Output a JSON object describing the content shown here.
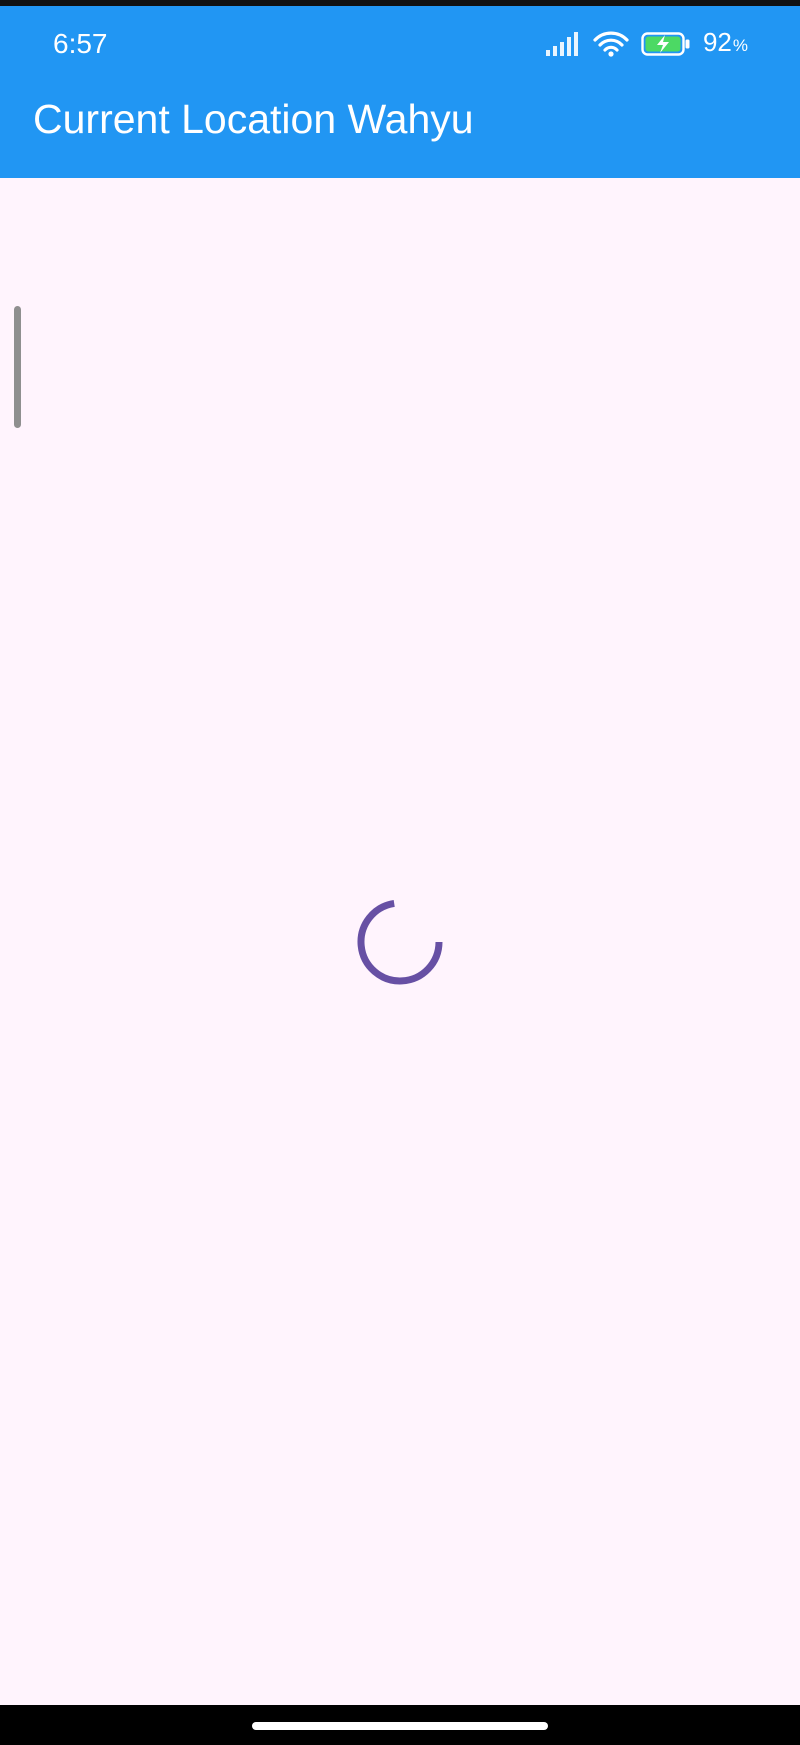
{
  "status_bar": {
    "time": "6:57",
    "battery_value": "92",
    "battery_unit": "%",
    "battery_level": 0.92,
    "icons": [
      "signal-icon",
      "wifi-icon",
      "battery-charging-icon"
    ]
  },
  "app_bar": {
    "title": "Current Location Wahyu",
    "color": "#2196f3"
  },
  "content": {
    "background": "#fff4fd",
    "loading_indicator": "progress-spinner-icon",
    "spinner_color": "#6750a4"
  }
}
